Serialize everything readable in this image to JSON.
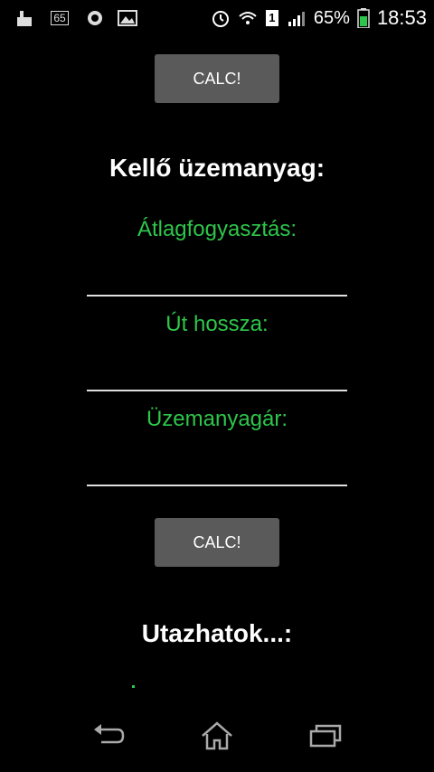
{
  "status_bar": {
    "notification_badge": "65",
    "battery_percent": "65%",
    "time": "18:53",
    "sim_slot": "1"
  },
  "buttons": {
    "calc_top": "CALC!",
    "calc_main": "CALC!"
  },
  "section_fuel": {
    "heading": "Kellő üzemanyag:",
    "fields": [
      {
        "label": "Átlagfogyasztás:",
        "value": ""
      },
      {
        "label": "Út hossza:",
        "value": ""
      },
      {
        "label": "Üzemanyagár:",
        "value": ""
      }
    ]
  },
  "section_travel": {
    "heading": "Utazhatok...:"
  },
  "colors": {
    "background": "#000000",
    "label_green": "#2ec64a",
    "button_gray": "#5a5a5a"
  }
}
